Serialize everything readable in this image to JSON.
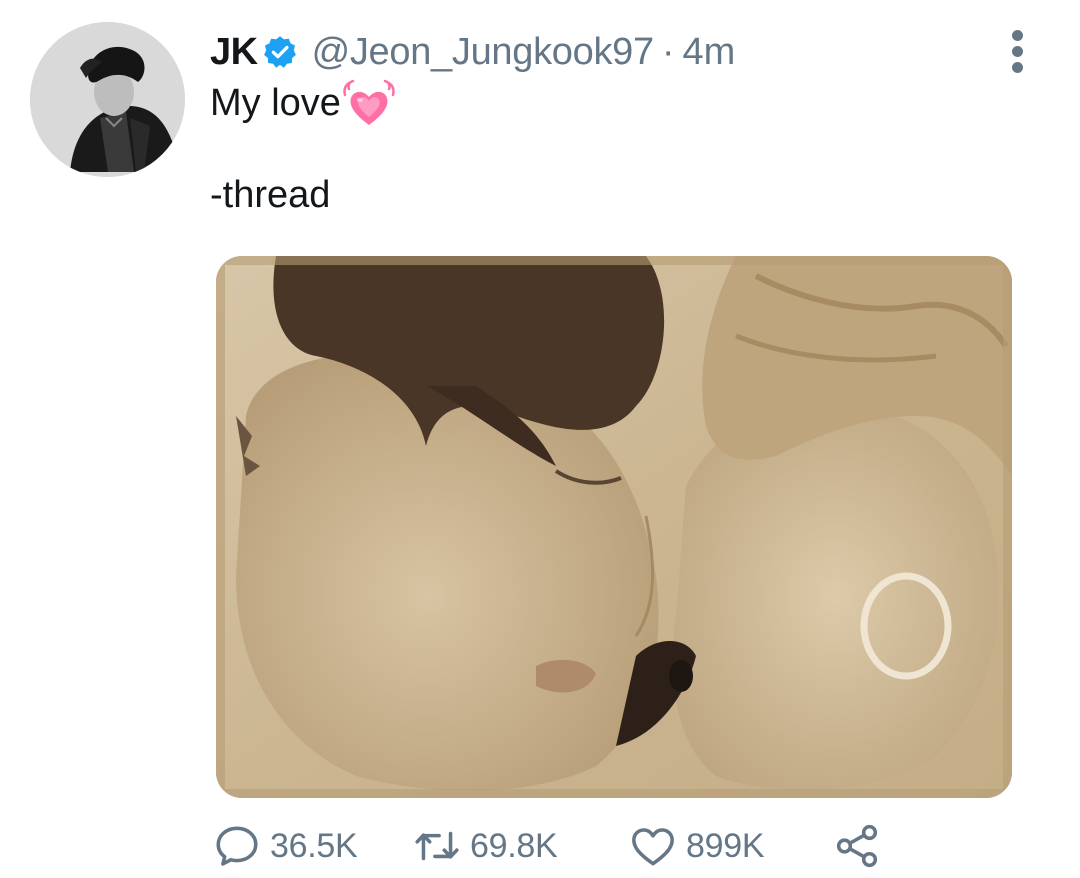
{
  "tweet": {
    "display_name": "JK",
    "handle": "@Jeon_Jungkook97",
    "separator": "·",
    "time": "4m",
    "text_line1": "My love",
    "text_line2": "-thread"
  },
  "icons": {
    "verified": "verified-badge-icon",
    "heart_emoji": "growing-heart-emoji",
    "more": "more-options-icon",
    "reply": "reply-icon",
    "retweet": "retweet-icon",
    "like": "like-icon",
    "share": "share-icon"
  },
  "actions": {
    "replies": "36.5K",
    "retweets": "69.8K",
    "likes": "899K"
  },
  "colors": {
    "verified_blue": "#1da1f2",
    "secondary_text": "#657786",
    "primary_text": "#14171a",
    "heart_pink": "#ff6fa5"
  }
}
